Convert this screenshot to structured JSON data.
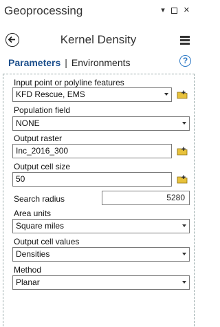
{
  "pane": {
    "title": "Geoprocessing",
    "pin_glyph": "▾",
    "close_glyph": "✕"
  },
  "tool": {
    "name": "Kernel Density"
  },
  "tabs": {
    "parameters": "Parameters",
    "separator": "|",
    "environments": "Environments",
    "help_glyph": "?"
  },
  "params": {
    "input_label": "Input point or polyline features",
    "input_value": "KFD Rescue, EMS",
    "population_label": "Population field",
    "population_value": "NONE",
    "output_raster_label": "Output raster",
    "output_raster_value": "Inc_2016_300",
    "cell_size_label": "Output cell size",
    "cell_size_value": "50",
    "search_radius_label": "Search radius",
    "search_radius_value": "5280",
    "area_units_label": "Area units",
    "area_units_value": "Square miles",
    "cell_values_label": "Output cell values",
    "cell_values_value": "Densities",
    "method_label": "Method",
    "method_value": "Planar"
  },
  "colors": {
    "tab_active": "#1c4f8c",
    "help_blue": "#2b78c5",
    "folder_yellow": "#e8c23c"
  }
}
